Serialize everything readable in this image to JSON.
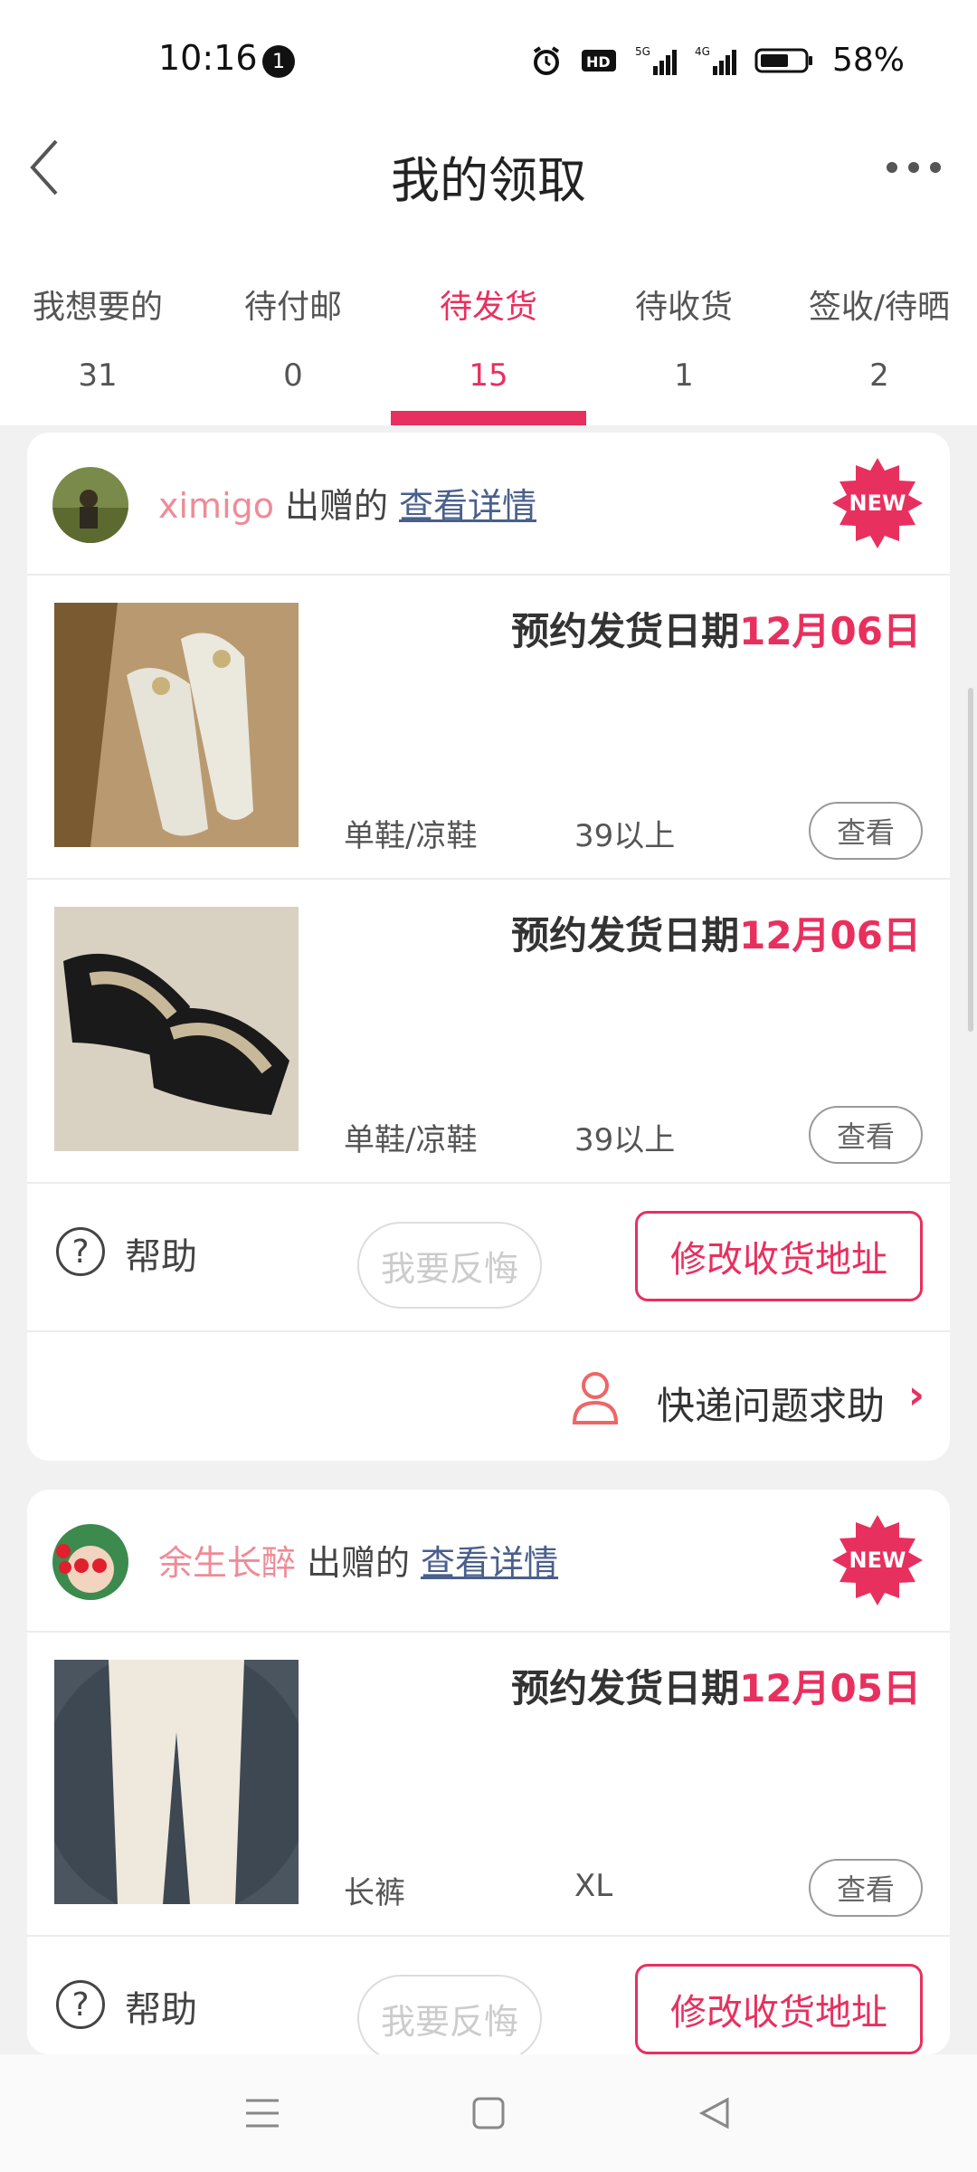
{
  "status_bar": {
    "time": "10:16",
    "notification_count": "1",
    "battery": "58%"
  },
  "header": {
    "title": "我的领取"
  },
  "tabs": [
    {
      "label": "我想要的",
      "count": "31"
    },
    {
      "label": "待付邮",
      "count": "0"
    },
    {
      "label": "待发货",
      "count": "15",
      "active": true
    },
    {
      "label": "待收货",
      "count": "1"
    },
    {
      "label": "签收/待晒",
      "count": "2"
    }
  ],
  "cards": [
    {
      "giver": "ximigo",
      "giver_suffix": "出赠的",
      "detail_link": "查看详情",
      "badge": "NEW",
      "items": [
        {
          "ship_label": "预约发货日期",
          "ship_date": "12月06日",
          "category": "单鞋/凉鞋",
          "size": "39以上",
          "view": "查看"
        },
        {
          "ship_label": "预约发货日期",
          "ship_date": "12月06日",
          "category": "单鞋/凉鞋",
          "size": "39以上",
          "view": "查看"
        }
      ],
      "help": "帮助",
      "regret": "我要反悔",
      "change_address": "修改收货地址",
      "express_help": "快递问题求助"
    },
    {
      "giver": "余生长醉",
      "giver_suffix": "出赠的",
      "detail_link": "查看详情",
      "badge": "NEW",
      "items": [
        {
          "ship_label": "预约发货日期",
          "ship_date": "12月05日",
          "category": "长裤",
          "size": "XL",
          "view": "查看"
        }
      ],
      "help": "帮助",
      "regret": "我要反悔",
      "change_address": "修改收货地址"
    }
  ],
  "colors": {
    "accent": "#e8305f",
    "giver_name": "#ef8b97",
    "link": "#4a5f8c"
  }
}
